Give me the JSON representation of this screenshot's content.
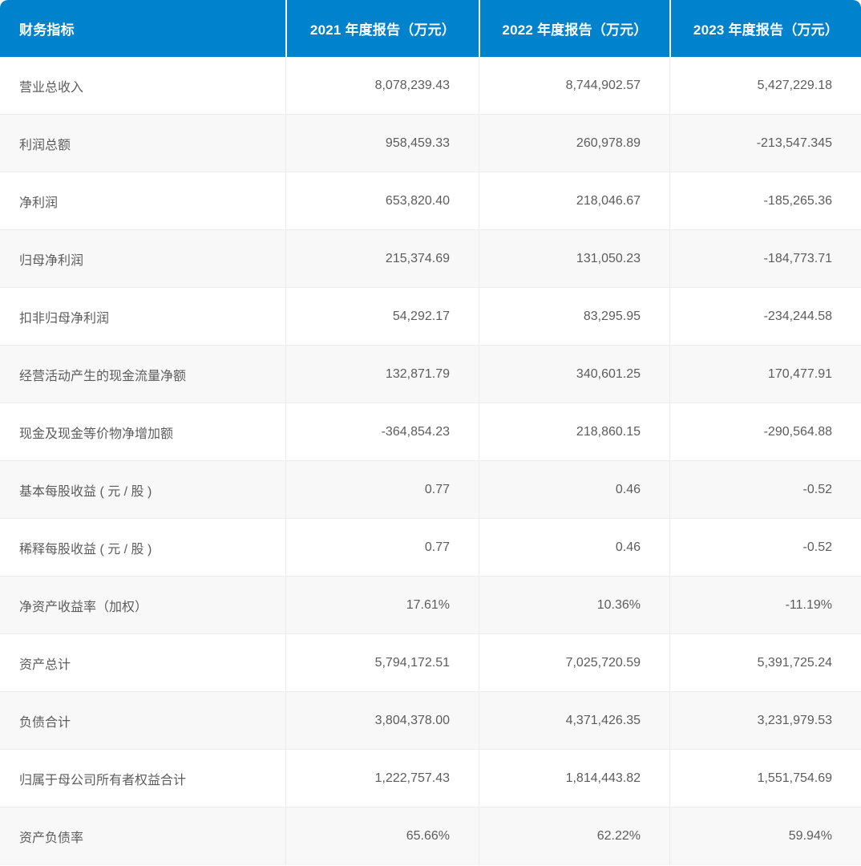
{
  "table": {
    "columns": [
      "财务指标",
      "2021 年度报告（万元）",
      "2022 年度报告（万元）",
      "2023 年度报告（万元）"
    ],
    "rows": [
      {
        "label": "营业总收入",
        "y2021": "8,078,239.43",
        "y2022": "8,744,902.57",
        "y2023": "5,427,229.18"
      },
      {
        "label": "利润总额",
        "y2021": "958,459.33",
        "y2022": "260,978.89",
        "y2023": "-213,547.345"
      },
      {
        "label": "净利润",
        "y2021": "653,820.40",
        "y2022": "218,046.67",
        "y2023": "-185,265.36"
      },
      {
        "label": "归母净利润",
        "y2021": "215,374.69",
        "y2022": "131,050.23",
        "y2023": "-184,773.71"
      },
      {
        "label": "扣非归母净利润",
        "y2021": "54,292.17",
        "y2022": "83,295.95",
        "y2023": "-234,244.58"
      },
      {
        "label": "经营活动产生的现金流量净额",
        "y2021": "132,871.79",
        "y2022": "340,601.25",
        "y2023": "170,477.91"
      },
      {
        "label": "现金及现金等价物净增加额",
        "y2021": "-364,854.23",
        "y2022": "218,860.15",
        "y2023": "-290,564.88"
      },
      {
        "label": "基本每股收益 ( 元 / 股 )",
        "y2021": "0.77",
        "y2022": "0.46",
        "y2023": "-0.52"
      },
      {
        "label": "稀释每股收益 ( 元 / 股 )",
        "y2021": "0.77",
        "y2022": "0.46",
        "y2023": "-0.52"
      },
      {
        "label": "净资产收益率（加权）",
        "y2021": "17.61%",
        "y2022": "10.36%",
        "y2023": "-11.19%"
      },
      {
        "label": "资产总计",
        "y2021": "5,794,172.51",
        "y2022": "7,025,720.59",
        "y2023": "5,391,725.24"
      },
      {
        "label": "负债合计",
        "y2021": "3,804,378.00",
        "y2022": "4,371,426.35",
        "y2023": "3,231,979.53"
      },
      {
        "label": "归属于母公司所有者权益合计",
        "y2021": "1,222,757.43",
        "y2022": "1,814,443.82",
        "y2023": "1,551,754.69"
      },
      {
        "label": "资产负债率",
        "y2021": "65.66%",
        "y2022": "62.22%",
        "y2023": "59.94%"
      }
    ]
  },
  "colors": {
    "header_bg": "#0182cd",
    "header_text": "#ffffff",
    "row_alt_bg": "#f8f8f8",
    "body_text": "#5c5c5c",
    "divider_h": "#ededed",
    "divider_v": "#ebebeb"
  }
}
